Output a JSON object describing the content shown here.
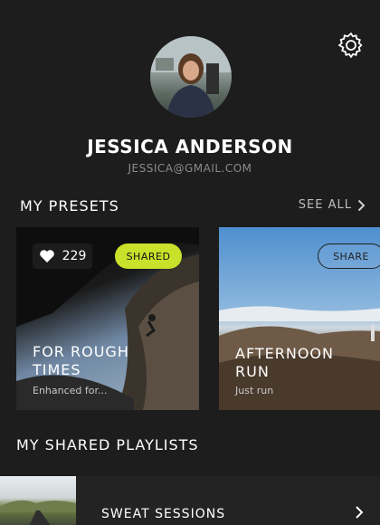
{
  "profile": {
    "name": "JESSICA ANDERSON",
    "email": "JESSICA@GMAIL.COM"
  },
  "presets": {
    "title": "MY PRESETS",
    "see_all": "SEE ALL",
    "cards": [
      {
        "title": "FOR ROUGH TIMES",
        "subtitle": "Enhanced for...",
        "likes": "229",
        "badge": "SHARED"
      },
      {
        "title": "AFTERNOON RUN",
        "subtitle": "Just run",
        "badge": "SHARE"
      }
    ]
  },
  "playlists": {
    "title": "MY SHARED PLAYLISTS",
    "items": [
      {
        "name": "SWEAT SESSIONS"
      }
    ]
  },
  "colors": {
    "background": "#1d1d1d",
    "accent": "#c8e12a"
  }
}
